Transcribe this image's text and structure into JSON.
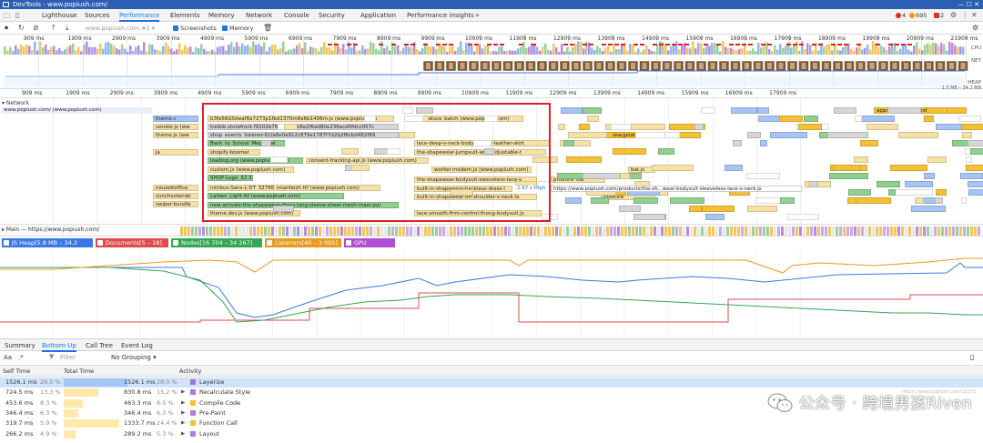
{
  "window": {
    "title": "DevTools - www.popiush.com/"
  },
  "tabs": [
    "Lighthouse",
    "Sources",
    "Performance",
    "Elements",
    "Memory",
    "Network",
    "Console",
    "Security",
    "Application",
    "Performance insights"
  ],
  "status": {
    "errors": "4",
    "warnings": "695",
    "info": "2"
  },
  "toolbar": {
    "profile_select": "www.popiush.com #1",
    "screenshots_label": "Screenshots",
    "memory_label": "Memory"
  },
  "overview_ticks": [
    "909 ms",
    "1909 ms",
    "2909 ms",
    "3909 ms",
    "4909 ms",
    "5909 ms",
    "6909 ms",
    "7909 ms",
    "8909 ms",
    "9909 ms",
    "10909 ms",
    "11909 ms",
    "12909 ms",
    "13909 ms",
    "14909 ms",
    "15909 ms",
    "16909 ms",
    "17909 ms",
    "18909 ms",
    "19909 ms",
    "20909 ms",
    "21909 ms"
  ],
  "overview_side": {
    "cpu": "CPU",
    "net": "NET",
    "heap": "HEAP",
    "heap_range": "1.5 MB – 34.2 MB"
  },
  "ruler_ticks": [
    "909 ms",
    "1909 ms",
    "2909 ms",
    "3909 ms",
    "4909 ms",
    "5909 ms",
    "6909 ms",
    "7909 ms",
    "8909 ms",
    "9909 ms",
    "10909 ms",
    "11909 ms",
    "12909 ms",
    "13909 ms",
    "14909 ms",
    "15909 ms",
    "16909 ms",
    "17909 ms"
  ],
  "network": {
    "label": "Network",
    "first_row": "www.popiush.com/ (www.popiush.com)",
    "left_items": [
      "theme.c",
      "vendor.js (ww",
      "theme.js (ww",
      "ja",
      "neuzeitoffice",
      "sunchestende",
      "swiper-bundle"
    ],
    "center_items": [
      "b3fe68d3dwaf8a7273p1fbd1370m8a6b1406m.js (www.popiush.co",
      "treikle.storefront.f9102b76c4156d16a2f6ad80e236ecd0fdcc057c",
      "shop_events_listener-61fa8e0a912c879e1787f7d2b2f6cbd482f89",
      "Back_to_School_Mega_Sal",
      "shopify-boomer",
      "loading.org (www.popiush.com)",
      "custom.js (www.popiush.com)",
      "SHOP-Logo_32-3",
      "nimbus-Sans-L-DT_32766_mianfeizh.ttf (www.popiush.com)",
      "Larken_Light.ttf (www.popiush.com)",
      "new-arrivals-the-shapewear-dress-long-sleeve-sheer-mesh-maxi-pur",
      "theme.dev.js (www.popiush.com)"
    ],
    "mid_items": [
      "produce_batch (www.popiush.com)",
      "lace-deep-v-neck-bodysuits-or-leather-skirt",
      "the-shapewear-jumpsuit-with-adjustable-t",
      "consent-tracking-api.js (www.popiush.com)",
      "worker.modern.js (www.popiush.com)",
      "the-shapewear-bodysuit-sleeveless-lace-v",
      "built-in-shapewear-backless-dress-l",
      "built-in-shapewear-off-shoulder-v-neck-lo",
      "lace-smooth-firm-control-thong-bodysuit.js"
    ],
    "tooltip_time": "2.87 s High",
    "tooltip_url": "https://www.popiush.com/products/the-sh...wear-bodysuit-sleeveless-lace-v-neck.js",
    "right_items": [
      "mvmmobilk (www.gstatic.com)",
      "bat.js",
      "produce_bat",
      "produce",
      "apps.latest.en.e85d",
      "latest.en.e5"
    ]
  },
  "main_row": "Main — https://www.popiush.com/",
  "mem_legend": [
    {
      "label": "JS Heap[5.8 MB – 34.2 MB]",
      "color": "#3b78e7"
    },
    {
      "label": "Documents[5 – 18]",
      "color": "#e04b4b"
    },
    {
      "label": "Nodes[16 704 – 34 267]",
      "color": "#32a852"
    },
    {
      "label": "Listeners[40 – 3 095]",
      "color": "#e89a1b"
    },
    {
      "label": "GPU Memory",
      "color": "#b04fd1"
    }
  ],
  "bottom_tabs": [
    "Summary",
    "Bottom-Up",
    "Call Tree",
    "Event Log"
  ],
  "filter": {
    "aa": "Aa",
    "filter_placeholder": "Filter",
    "grouping": "No Grouping"
  },
  "columns": {
    "self": "Self Time",
    "total": "Total Time",
    "activity": "Activity"
  },
  "rows": [
    {
      "self": "1526.1 ms",
      "self_pct": "28.0 %",
      "total": "1526.1 ms",
      "total_pct": "28.0 %",
      "activity": "Layerize",
      "color": "#9c78d4",
      "frac": 0.28,
      "expand": false
    },
    {
      "self": "724.5 ms",
      "self_pct": "13.3 %",
      "total": "830.8 ms",
      "total_pct": "15.2 %",
      "activity": "Recalculate Style",
      "color": "#a77be5",
      "frac": 0.152,
      "expand": true
    },
    {
      "self": "453.6 ms",
      "self_pct": "8.3 %",
      "total": "463.3 ms",
      "total_pct": "8.5 %",
      "activity": "Compile Code",
      "color": "#f2c232",
      "frac": 0.085,
      "expand": true
    },
    {
      "self": "346.4 ms",
      "self_pct": "6.3 %",
      "total": "346.4 ms",
      "total_pct": "6.3 %",
      "activity": "Pre-Paint",
      "color": "#b07ce0",
      "frac": 0.063,
      "expand": true
    },
    {
      "self": "319.7 ms",
      "self_pct": "5.9 %",
      "total": "1333.7 ms",
      "total_pct": "24.4 %",
      "activity": "Function Call",
      "color": "#f2c232",
      "frac": 0.244,
      "expand": true
    },
    {
      "self": "266.2 ms",
      "self_pct": "4.9 %",
      "total": "289.2 ms",
      "total_pct": "5.3 %",
      "activity": "Layout",
      "color": "#b07ce0",
      "frac": 0.053,
      "expand": true
    }
  ],
  "watermark": {
    "text": "公众号 · 跨境男孩Riven",
    "url_hint": "https://www.popiush.com/15273"
  }
}
